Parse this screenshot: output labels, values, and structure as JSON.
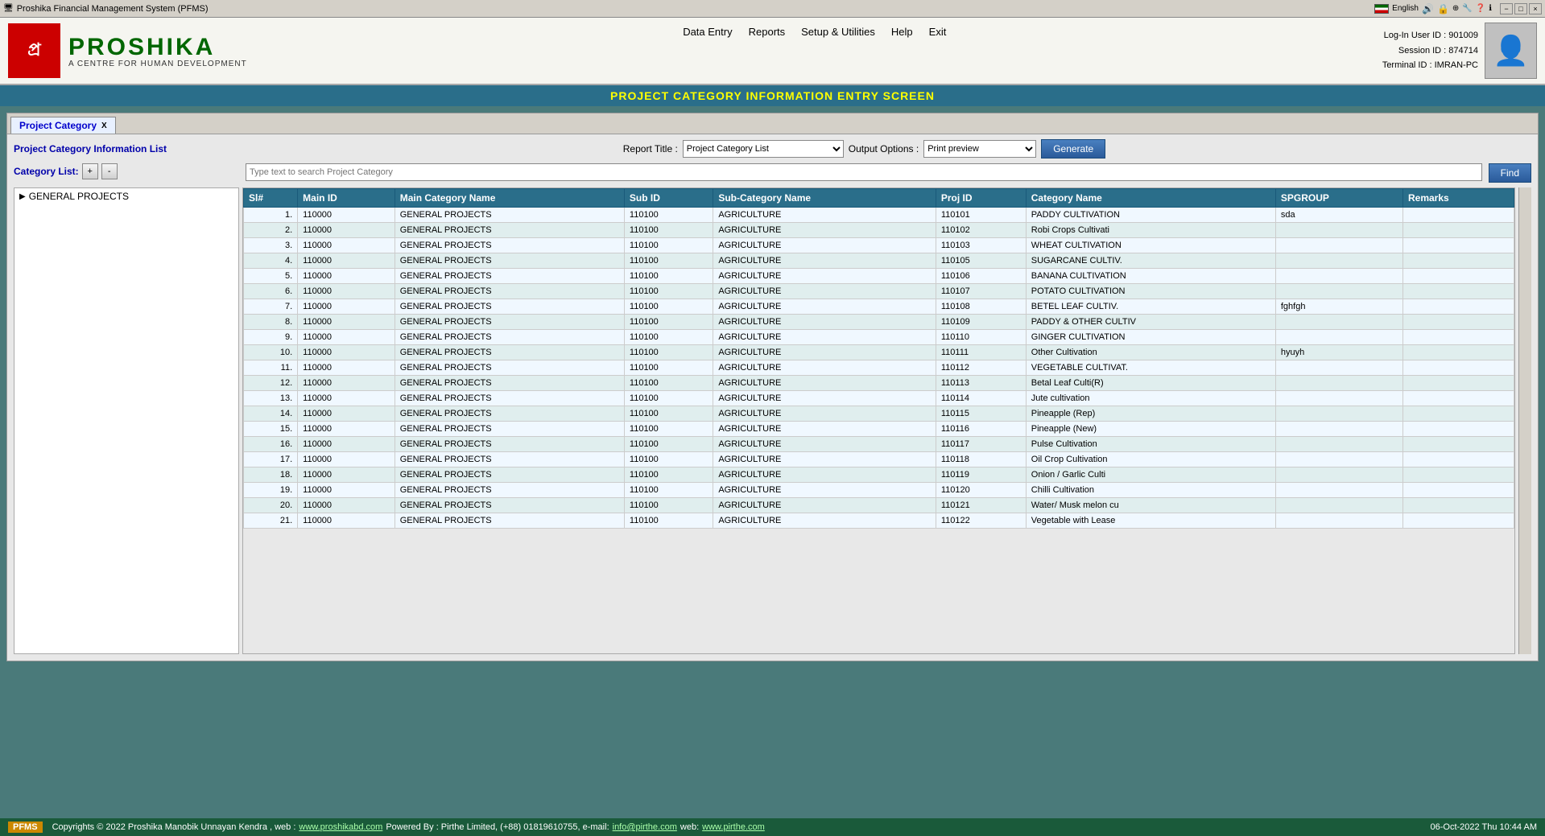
{
  "titlebar": {
    "title": "Proshika Financial Management System (PFMS)",
    "minimize": "−",
    "maximize": "□",
    "close": "×"
  },
  "taskbar": {
    "lang": "English"
  },
  "header": {
    "logo_char": "প্র",
    "logo_name": "PROSHIKA",
    "logo_tagline": "A CENTRE FOR HUMAN DEVELOPMENT",
    "nav": [
      "Data Entry",
      "Reports",
      "Setup & Utilities",
      "Help",
      "Exit"
    ],
    "user_info": {
      "login": "Log-In User ID : 901009",
      "session": "Session ID : 874714",
      "terminal": "Terminal ID : IMRAN-PC"
    }
  },
  "page_title": "PROJECT CATEGORY INFORMATION ENTRY SCREEN",
  "tab": {
    "label": "Project Category",
    "close": "X"
  },
  "list_title": "Project Category Information List",
  "category_list_label": "Category List:",
  "btn_plus": "+",
  "btn_minus": "-",
  "search_placeholder": "Type text to search Project Category",
  "find_btn": "Find",
  "report_title_label": "Report Title :",
  "report_title_value": "Project Category List",
  "output_options_label": "Output Options :",
  "output_options_value": "Print preview",
  "generate_btn": "Generate",
  "tree": {
    "items": [
      {
        "label": "GENERAL PROJECTS",
        "arrow": "▶"
      }
    ]
  },
  "table": {
    "columns": [
      "Sl#",
      "Main ID",
      "Main Category Name",
      "Sub ID",
      "Sub-Category Name",
      "Proj ID",
      "Category Name",
      "SPGROUP",
      "Remarks"
    ],
    "rows": [
      {
        "sl": "1.",
        "main_id": "110000",
        "main_cat": "GENERAL PROJECTS",
        "sub_id": "110100",
        "sub_cat": "AGRICULTURE",
        "proj_id": "110101",
        "cat_name": "PADDY CULTIVATION",
        "spgroup": "sda",
        "remarks": ""
      },
      {
        "sl": "2.",
        "main_id": "110000",
        "main_cat": "GENERAL PROJECTS",
        "sub_id": "110100",
        "sub_cat": "AGRICULTURE",
        "proj_id": "110102",
        "cat_name": "Robi Crops Cultivati",
        "spgroup": "",
        "remarks": ""
      },
      {
        "sl": "3.",
        "main_id": "110000",
        "main_cat": "GENERAL PROJECTS",
        "sub_id": "110100",
        "sub_cat": "AGRICULTURE",
        "proj_id": "110103",
        "cat_name": "WHEAT CULTIVATION",
        "spgroup": "",
        "remarks": ""
      },
      {
        "sl": "4.",
        "main_id": "110000",
        "main_cat": "GENERAL PROJECTS",
        "sub_id": "110100",
        "sub_cat": "AGRICULTURE",
        "proj_id": "110105",
        "cat_name": "SUGARCANE CULTIV.",
        "spgroup": "",
        "remarks": ""
      },
      {
        "sl": "5.",
        "main_id": "110000",
        "main_cat": "GENERAL PROJECTS",
        "sub_id": "110100",
        "sub_cat": "AGRICULTURE",
        "proj_id": "110106",
        "cat_name": "BANANA CULTIVATION",
        "spgroup": "",
        "remarks": ""
      },
      {
        "sl": "6.",
        "main_id": "110000",
        "main_cat": "GENERAL PROJECTS",
        "sub_id": "110100",
        "sub_cat": "AGRICULTURE",
        "proj_id": "110107",
        "cat_name": "POTATO CULTIVATION",
        "spgroup": "",
        "remarks": ""
      },
      {
        "sl": "7.",
        "main_id": "110000",
        "main_cat": "GENERAL PROJECTS",
        "sub_id": "110100",
        "sub_cat": "AGRICULTURE",
        "proj_id": "110108",
        "cat_name": "BETEL LEAF CULTIV.",
        "spgroup": "fghfgh",
        "remarks": ""
      },
      {
        "sl": "8.",
        "main_id": "110000",
        "main_cat": "GENERAL PROJECTS",
        "sub_id": "110100",
        "sub_cat": "AGRICULTURE",
        "proj_id": "110109",
        "cat_name": "PADDY & OTHER CULTIV",
        "spgroup": "",
        "remarks": ""
      },
      {
        "sl": "9.",
        "main_id": "110000",
        "main_cat": "GENERAL PROJECTS",
        "sub_id": "110100",
        "sub_cat": "AGRICULTURE",
        "proj_id": "110110",
        "cat_name": "GINGER CULTIVATION",
        "spgroup": "",
        "remarks": ""
      },
      {
        "sl": "10.",
        "main_id": "110000",
        "main_cat": "GENERAL PROJECTS",
        "sub_id": "110100",
        "sub_cat": "AGRICULTURE",
        "proj_id": "110111",
        "cat_name": "Other Cultivation",
        "spgroup": "hyuyh",
        "remarks": ""
      },
      {
        "sl": "11.",
        "main_id": "110000",
        "main_cat": "GENERAL PROJECTS",
        "sub_id": "110100",
        "sub_cat": "AGRICULTURE",
        "proj_id": "110112",
        "cat_name": "VEGETABLE CULTIVAT.",
        "spgroup": "",
        "remarks": ""
      },
      {
        "sl": "12.",
        "main_id": "110000",
        "main_cat": "GENERAL PROJECTS",
        "sub_id": "110100",
        "sub_cat": "AGRICULTURE",
        "proj_id": "110113",
        "cat_name": "Betal Leaf Culti(R)",
        "spgroup": "",
        "remarks": ""
      },
      {
        "sl": "13.",
        "main_id": "110000",
        "main_cat": "GENERAL PROJECTS",
        "sub_id": "110100",
        "sub_cat": "AGRICULTURE",
        "proj_id": "110114",
        "cat_name": "Jute cultivation",
        "spgroup": "",
        "remarks": ""
      },
      {
        "sl": "14.",
        "main_id": "110000",
        "main_cat": "GENERAL PROJECTS",
        "sub_id": "110100",
        "sub_cat": "AGRICULTURE",
        "proj_id": "110115",
        "cat_name": "Pineapple (Rep)",
        "spgroup": "",
        "remarks": ""
      },
      {
        "sl": "15.",
        "main_id": "110000",
        "main_cat": "GENERAL PROJECTS",
        "sub_id": "110100",
        "sub_cat": "AGRICULTURE",
        "proj_id": "110116",
        "cat_name": "Pineapple (New)",
        "spgroup": "",
        "remarks": ""
      },
      {
        "sl": "16.",
        "main_id": "110000",
        "main_cat": "GENERAL PROJECTS",
        "sub_id": "110100",
        "sub_cat": "AGRICULTURE",
        "proj_id": "110117",
        "cat_name": "Pulse Cultivation",
        "spgroup": "",
        "remarks": ""
      },
      {
        "sl": "17.",
        "main_id": "110000",
        "main_cat": "GENERAL PROJECTS",
        "sub_id": "110100",
        "sub_cat": "AGRICULTURE",
        "proj_id": "110118",
        "cat_name": "Oil Crop Cultivation",
        "spgroup": "",
        "remarks": ""
      },
      {
        "sl": "18.",
        "main_id": "110000",
        "main_cat": "GENERAL PROJECTS",
        "sub_id": "110100",
        "sub_cat": "AGRICULTURE",
        "proj_id": "110119",
        "cat_name": "Onion / Garlic Culti",
        "spgroup": "",
        "remarks": ""
      },
      {
        "sl": "19.",
        "main_id": "110000",
        "main_cat": "GENERAL PROJECTS",
        "sub_id": "110100",
        "sub_cat": "AGRICULTURE",
        "proj_id": "110120",
        "cat_name": "Chilli Cultivation",
        "spgroup": "",
        "remarks": ""
      },
      {
        "sl": "20.",
        "main_id": "110000",
        "main_cat": "GENERAL PROJECTS",
        "sub_id": "110100",
        "sub_cat": "AGRICULTURE",
        "proj_id": "110121",
        "cat_name": "Water/ Musk melon cu",
        "spgroup": "",
        "remarks": ""
      },
      {
        "sl": "21.",
        "main_id": "110000",
        "main_cat": "GENERAL PROJECTS",
        "sub_id": "110100",
        "sub_cat": "AGRICULTURE",
        "proj_id": "110122",
        "cat_name": "Vegetable with Lease",
        "spgroup": "",
        "remarks": ""
      }
    ]
  },
  "footer": {
    "badge": "PFMS",
    "copyright": "Copyrights © 2022 Proshika Manobik Unnayan Kendra , web :",
    "web1": "www.proshikabd.com",
    "powered": "Powered By : Pirthe Limited, (+88) 01819610755, e-mail:",
    "email": "info@pirthe.com",
    "web2_label": "web:",
    "web2": "www.pirthe.com",
    "datetime": "06-Oct-2022 Thu 10:44 AM"
  }
}
